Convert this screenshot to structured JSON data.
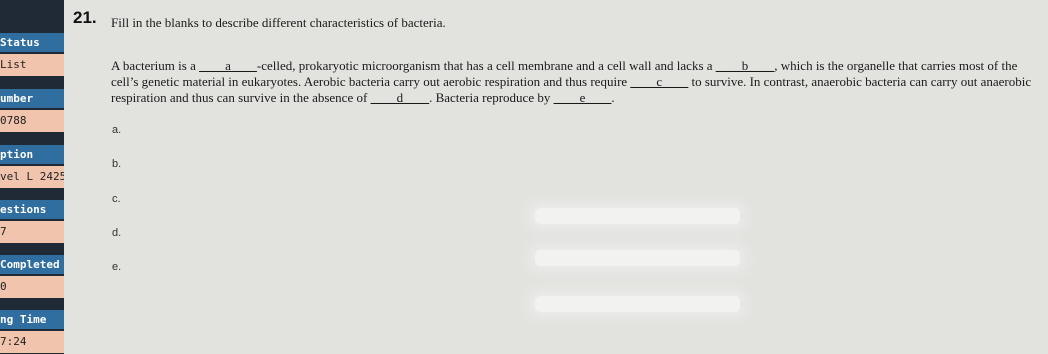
{
  "sidebar": {
    "items": [
      {
        "label": "Status",
        "value": "List"
      },
      {
        "label": "umber",
        "value": "0788"
      },
      {
        "label": "ption",
        "value": "vel L 2425"
      },
      {
        "label": "estions",
        "value": "7"
      },
      {
        "label": "Completed",
        "value": "0"
      },
      {
        "label": "ng Time",
        "value": "7:24"
      }
    ]
  },
  "question": {
    "number": "21.",
    "prompt": "Fill in the blanks to describe different characteristics of bacteria.",
    "passage": {
      "t1": "A bacterium is a ",
      "blank_a": "____a____",
      "t2": "-celled, prokaryotic microorganism that has a cell membrane and a cell wall and lacks a ",
      "blank_b": "____b____",
      "t3": ", which is the organelle that carries most of the cell’s genetic material in eukaryotes. Aerobic bacteria carry out aerobic respiration and thus require ",
      "blank_c": "____c____",
      "t4": " to survive. In contrast, anaerobic bacteria can carry out anaerobic respiration and thus can survive in the absence of ",
      "blank_d": "____d____",
      "t5": ". Bacteria reproduce by ",
      "blank_e": "____e____",
      "t6": "."
    },
    "answers": [
      "a.",
      "b.",
      "c.",
      "d.",
      "e."
    ]
  }
}
